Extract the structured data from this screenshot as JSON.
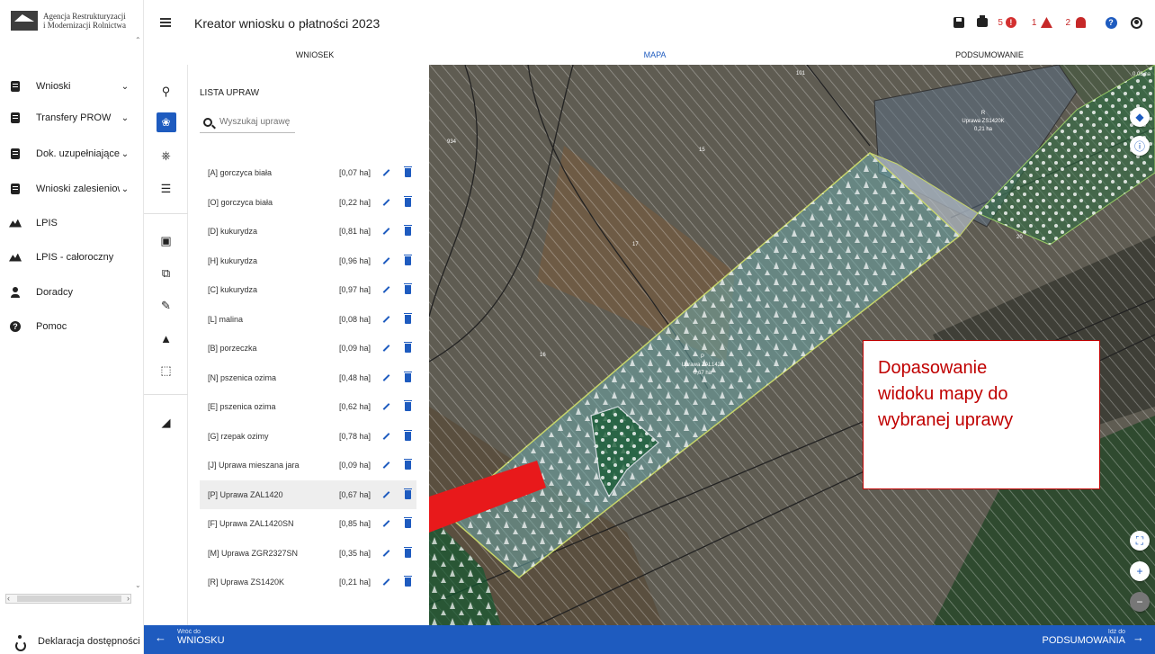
{
  "logo": {
    "line1": "Agencja Restrukturyzacji",
    "line2": "i Modernizacji Rolnictwa"
  },
  "sidebar": {
    "items": [
      {
        "label": "Wnioski",
        "icon": "document-icon",
        "has_chevron": true
      },
      {
        "label": "Transfery PROW",
        "icon": "document-icon",
        "has_chevron": true
      },
      {
        "label": "Dok. uzupełniające",
        "icon": "document-icon",
        "has_chevron": true
      },
      {
        "label": "Wnioski zalesieniowe",
        "icon": "document-icon",
        "has_chevron": true
      },
      {
        "label": "LPIS",
        "icon": "mountain-icon",
        "has_chevron": false
      },
      {
        "label": "LPIS - całoroczny",
        "icon": "mountain-icon",
        "has_chevron": false
      },
      {
        "label": "Doradcy",
        "icon": "person-icon",
        "has_chevron": false
      },
      {
        "label": "Pomoc",
        "icon": "help-icon",
        "has_chevron": false
      }
    ],
    "accessibility": "Deklaracja dostępności"
  },
  "header": {
    "title": "Kreator wniosku o płatności 2023",
    "errors_count": "5",
    "warnings_count": "1",
    "notifications_count": "2"
  },
  "tabs": [
    {
      "label": "WNIOSEK",
      "active": false
    },
    {
      "label": "MAPA",
      "active": true
    },
    {
      "label": "PODSUMOWANIE",
      "active": false
    }
  ],
  "panel": {
    "title": "LISTA UPRAW",
    "search_placeholder": "Wyszukaj uprawę",
    "crops": [
      {
        "name": "[A] gorczyca biała",
        "area": "[0,07 ha]"
      },
      {
        "name": "[O] gorczyca biała",
        "area": "[0,22 ha]"
      },
      {
        "name": "[D] kukurydza",
        "area": "[0,81 ha]"
      },
      {
        "name": "[H] kukurydza",
        "area": "[0,96 ha]"
      },
      {
        "name": "[C] kukurydza",
        "area": "[0,97 ha]"
      },
      {
        "name": "[L] malina",
        "area": "[0,08 ha]"
      },
      {
        "name": "[B] porzeczka",
        "area": "[0,09 ha]"
      },
      {
        "name": "[N] pszenica ozima",
        "area": "[0,48 ha]"
      },
      {
        "name": "[E] pszenica ozima",
        "area": "[0,62 ha]"
      },
      {
        "name": "[G] rzepak ozimy",
        "area": "[0,78 ha]"
      },
      {
        "name": "[J] Uprawa mieszana jara",
        "area": "[0,09 ha]"
      },
      {
        "name": "[P] Uprawa ZAL1420",
        "area": "[0,67 ha]",
        "selected": true
      },
      {
        "name": "[F] Uprawa ZAL1420SN",
        "area": "[0,85 ha]"
      },
      {
        "name": "[M] Uprawa ZGR2327SN",
        "area": "[0,35 ha]"
      },
      {
        "name": "[R] Uprawa ZS1420K",
        "area": "[0,21 ha]"
      }
    ]
  },
  "map": {
    "labels": {
      "l101": "101",
      "l934": "934",
      "l15": "15",
      "l17": "17",
      "l16": "16",
      "l20": "20",
      "top_right_area": "0,08 ha",
      "r_letter": "R",
      "r_name": "Uprawa ZS1420K",
      "r_area": "0,21 ha",
      "p_letter": "P",
      "p_name": "Uprawa ZAL1420",
      "p_area": "0,67 ha"
    }
  },
  "annotation": {
    "line1": "Dopasowanie",
    "line2": "widoku mapy do",
    "line3": "wybranej uprawy"
  },
  "bottom": {
    "back_small": "Wróć do",
    "back_big": "WNIOSKU",
    "next_small": "Idź do",
    "next_big": "PODSUMOWANIA"
  },
  "colors": {
    "accent": "#1e5bbf",
    "error": "#d32f2f",
    "annotation_red": "#c00000",
    "arrow_red": "#e8191b"
  }
}
